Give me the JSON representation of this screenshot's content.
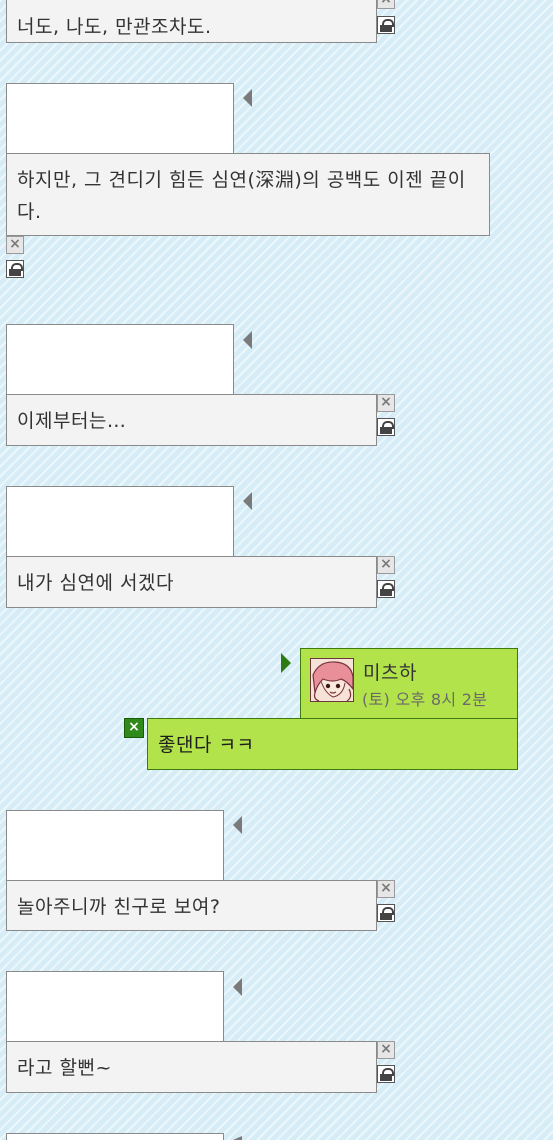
{
  "messages": [
    {
      "text": "너도, 나도, 만관조차도."
    },
    {
      "text": "하지만, 그 견디기 힘든 심연(深淵)의 공백도 이젠 끝이다."
    },
    {
      "text": "이제부터는…"
    },
    {
      "text": "내가 심연에 서겠다"
    },
    {
      "text": "좋댄다 ㅋㅋ"
    },
    {
      "text": "놀아주니까 친구로 보여?"
    },
    {
      "text": "라고 할뻔~"
    }
  ],
  "own_user": {
    "name": "미츠하",
    "time": "(토) 오후 8시 2분"
  },
  "icons": {
    "delete": "close-icon",
    "lock": "lock-icon",
    "own_delete": "close-icon"
  },
  "colors": {
    "background": "#d6edf7",
    "message_box": "#f3f3f3",
    "own_bubble": "#b2e34a",
    "own_border": "#3d7a0f"
  }
}
